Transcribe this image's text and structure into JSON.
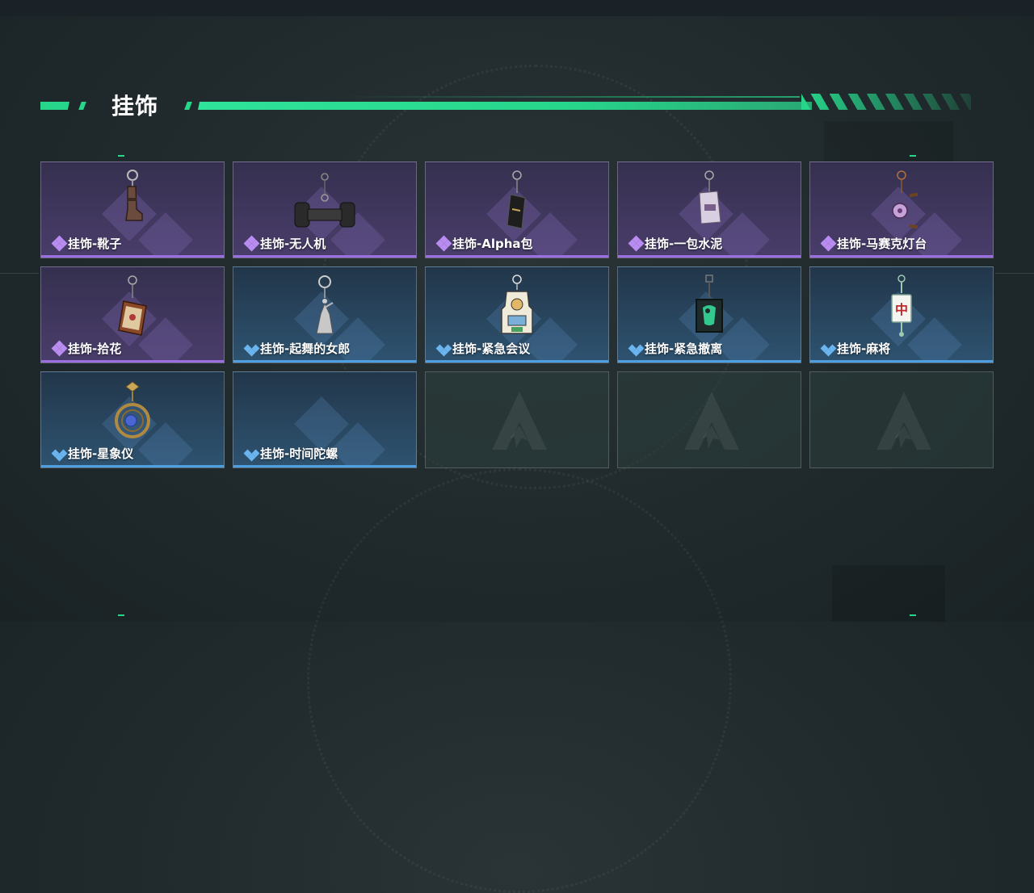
{
  "header": {
    "title": "挂饰"
  },
  "colors": {
    "accent": "#27d68b",
    "rarity_purple": "#9b6fe0",
    "rarity_blue": "#4f9ee0"
  },
  "items": [
    {
      "label": "挂饰-靴子",
      "rarity": "purple",
      "icon": "boot-charm-icon"
    },
    {
      "label": "挂饰-无人机",
      "rarity": "purple",
      "icon": "drone-charm-icon"
    },
    {
      "label": "挂饰-Alpha包",
      "rarity": "purple",
      "icon": "alpha-pack-charm-icon"
    },
    {
      "label": "挂饰-一包水泥",
      "rarity": "purple",
      "icon": "cement-bag-charm-icon"
    },
    {
      "label": "挂饰-马赛克灯台",
      "rarity": "purple",
      "icon": "mosaic-lamp-charm-icon"
    },
    {
      "label": "挂饰-拾花",
      "rarity": "purple",
      "icon": "flower-charm-icon"
    },
    {
      "label": "挂饰-起舞的女郎",
      "rarity": "blue",
      "icon": "dancer-charm-icon"
    },
    {
      "label": "挂饰-紧急会议",
      "rarity": "blue",
      "icon": "meeting-charm-icon"
    },
    {
      "label": "挂饰-紧急撤离",
      "rarity": "blue",
      "icon": "evacuation-charm-icon"
    },
    {
      "label": "挂饰-麻将",
      "rarity": "blue",
      "icon": "mahjong-charm-icon"
    },
    {
      "label": "挂饰-星象仪",
      "rarity": "blue",
      "icon": "astrolabe-charm-icon"
    },
    {
      "label": "挂饰-时间陀螺",
      "rarity": "blue",
      "icon": "time-top-charm-icon"
    }
  ],
  "mahjong_glyph": "中"
}
